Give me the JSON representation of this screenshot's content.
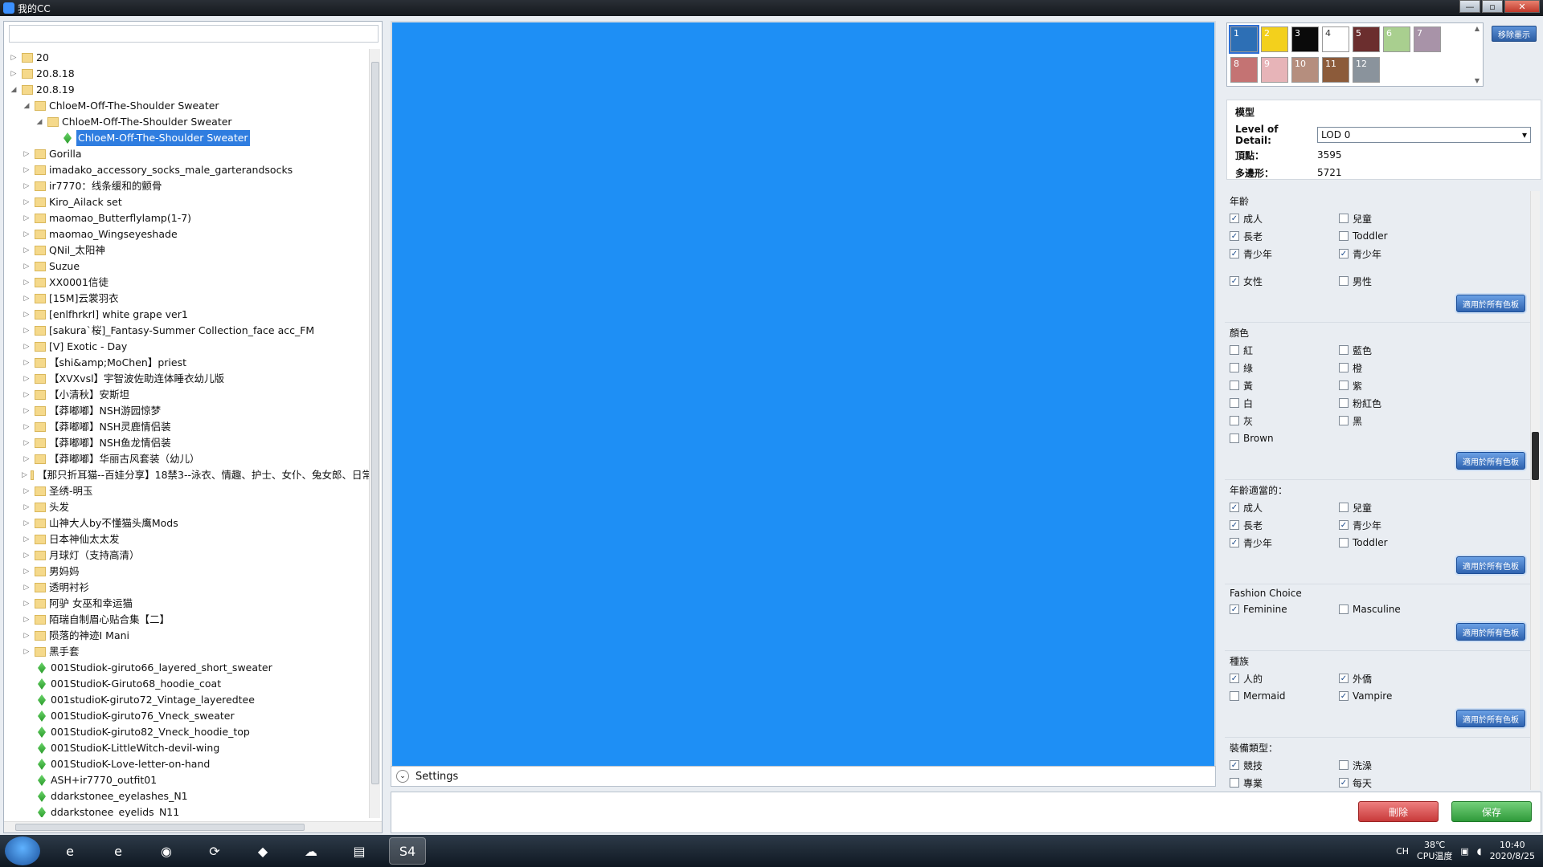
{
  "window": {
    "title": "我的CC",
    "min": "—",
    "max": "▫",
    "close": "✕"
  },
  "tree": {
    "rows": [
      {
        "label": "20",
        "type": "folder",
        "level": 0,
        "exp": "▷"
      },
      {
        "label": "20.8.18",
        "type": "folder",
        "level": 0,
        "exp": "▷"
      },
      {
        "label": "20.8.19",
        "type": "folder",
        "level": 0,
        "exp": "◢"
      },
      {
        "label": "ChloeM-Off-The-Shoulder Sweater",
        "type": "folder",
        "level": 1,
        "exp": "◢"
      },
      {
        "label": "ChloeM-Off-The-Shoulder Sweater",
        "type": "folder",
        "level": 2,
        "exp": "◢"
      },
      {
        "label": "ChloeM-Off-The-Shoulder Sweater",
        "type": "item",
        "level": 3,
        "exp": "",
        "selected": true
      },
      {
        "label": "Gorilla",
        "type": "folder",
        "level": 1,
        "exp": "▷"
      },
      {
        "label": "imadako_accessory_socks_male_garterandsocks",
        "type": "folder",
        "level": 1,
        "exp": "▷"
      },
      {
        "label": "ir7770：线条缓和的颤骨",
        "type": "folder",
        "level": 1,
        "exp": "▷"
      },
      {
        "label": "Kiro_Ailack set",
        "type": "folder",
        "level": 1,
        "exp": "▷"
      },
      {
        "label": "maomao_Butterflylamp(1-7)",
        "type": "folder",
        "level": 1,
        "exp": "▷"
      },
      {
        "label": "maomao_Wingseyeshade",
        "type": "folder",
        "level": 1,
        "exp": "▷"
      },
      {
        "label": "QNil_太阳神",
        "type": "folder",
        "level": 1,
        "exp": "▷"
      },
      {
        "label": "Suzue",
        "type": "folder",
        "level": 1,
        "exp": "▷"
      },
      {
        "label": "XX0001信徒",
        "type": "folder",
        "level": 1,
        "exp": "▷"
      },
      {
        "label": "[15M]云裳羽衣",
        "type": "folder",
        "level": 1,
        "exp": "▷"
      },
      {
        "label": "[enlfhrkrl] white grape ver1",
        "type": "folder",
        "level": 1,
        "exp": "▷"
      },
      {
        "label": "[sakura`桜]_Fantasy-Summer Collection_face acc_FM",
        "type": "folder",
        "level": 1,
        "exp": "▷"
      },
      {
        "label": "[V] Exotic - Day",
        "type": "folder",
        "level": 1,
        "exp": "▷"
      },
      {
        "label": "【shi&amp;MoChen】priest",
        "type": "folder",
        "level": 1,
        "exp": "▷"
      },
      {
        "label": "【XVXvsl】宇智波佐助连体睡衣幼儿版",
        "type": "folder",
        "level": 1,
        "exp": "▷"
      },
      {
        "label": "【小清秋】安斯坦",
        "type": "folder",
        "level": 1,
        "exp": "▷"
      },
      {
        "label": "【莽嘟嘟】NSH游园惊梦",
        "type": "folder",
        "level": 1,
        "exp": "▷"
      },
      {
        "label": "【莽嘟嘟】NSH灵鹿情侣装",
        "type": "folder",
        "level": 1,
        "exp": "▷"
      },
      {
        "label": "【莽嘟嘟】NSH鱼龙情侣装",
        "type": "folder",
        "level": 1,
        "exp": "▷"
      },
      {
        "label": "【莽嘟嘟】华丽古风套装（幼儿）",
        "type": "folder",
        "level": 1,
        "exp": "▷"
      },
      {
        "label": "【那只折耳猫--百娃分享】18禁3--泳衣、情趣、护士、女仆、兔女郎、日常",
        "type": "folder",
        "level": 1,
        "exp": "▷"
      },
      {
        "label": "圣绣-明玉",
        "type": "folder",
        "level": 1,
        "exp": "▷"
      },
      {
        "label": "头发",
        "type": "folder",
        "level": 1,
        "exp": "▷"
      },
      {
        "label": "山神大人by不懂猫头鹰Mods",
        "type": "folder",
        "level": 1,
        "exp": "▷"
      },
      {
        "label": "日本神仙太太发",
        "type": "folder",
        "level": 1,
        "exp": "▷"
      },
      {
        "label": "月球灯（支持高清）",
        "type": "folder",
        "level": 1,
        "exp": "▷"
      },
      {
        "label": "男妈妈",
        "type": "folder",
        "level": 1,
        "exp": "▷"
      },
      {
        "label": "透明衬衫",
        "type": "folder",
        "level": 1,
        "exp": "▷"
      },
      {
        "label": "阿驴 女巫和幸运猫",
        "type": "folder",
        "level": 1,
        "exp": "▷"
      },
      {
        "label": "陌瑞自制眉心贴合集【二】",
        "type": "folder",
        "level": 1,
        "exp": "▷"
      },
      {
        "label": "陨落的神迹I Mani",
        "type": "folder",
        "level": 1,
        "exp": "▷"
      },
      {
        "label": "黑手套",
        "type": "folder",
        "level": 1,
        "exp": "▷"
      },
      {
        "label": "001Studiok-giruto66_layered_short_sweater",
        "type": "item",
        "level": 1,
        "exp": ""
      },
      {
        "label": "001StudioK-Giruto68_hoodie_coat",
        "type": "item",
        "level": 1,
        "exp": ""
      },
      {
        "label": "001studioK-giruto72_Vintage_layeredtee",
        "type": "item",
        "level": 1,
        "exp": ""
      },
      {
        "label": "001StudioK-giruto76_Vneck_sweater",
        "type": "item",
        "level": 1,
        "exp": ""
      },
      {
        "label": "001StudioK-giruto82_Vneck_hoodie_top",
        "type": "item",
        "level": 1,
        "exp": ""
      },
      {
        "label": "001StudioK-LittleWitch-devil-wing",
        "type": "item",
        "level": 1,
        "exp": ""
      },
      {
        "label": "001StudioK-Love-letter-on-hand",
        "type": "item",
        "level": 1,
        "exp": ""
      },
      {
        "label": "ASH+ir7770_outfit01",
        "type": "item",
        "level": 1,
        "exp": ""
      },
      {
        "label": "ddarkstonee_eyelashes_N1",
        "type": "item",
        "level": 1,
        "exp": ""
      },
      {
        "label": "ddarkstonee_eyelids_N11",
        "type": "item",
        "level": 1,
        "exp": ""
      }
    ]
  },
  "viewport": {
    "color": "#1e8ff5",
    "settings_label": "Settings"
  },
  "swatches": [
    {
      "n": "1",
      "color": "#2d6fb5",
      "selected": true
    },
    {
      "n": "2",
      "color": "#f3d01c"
    },
    {
      "n": "3",
      "color": "#0a0a0a"
    },
    {
      "n": "4",
      "color": "#ffffff"
    },
    {
      "n": "5",
      "color": "#6b2e2e"
    },
    {
      "n": "6",
      "color": "#a9cf8f"
    },
    {
      "n": "7",
      "color": "#a893a8"
    },
    {
      "n": "8",
      "color": "#c47373"
    },
    {
      "n": "9",
      "color": "#e7b4b8"
    },
    {
      "n": "10",
      "color": "#b58e7e"
    },
    {
      "n": "11",
      "color": "#8c5b3a"
    },
    {
      "n": "12",
      "color": "#8a939c"
    }
  ],
  "remove_button": "移除墨示",
  "model": {
    "title": "模型",
    "lod_label": "Level of Detail:",
    "lod_value": "LOD 0",
    "vertices_label": "頂點：",
    "vertices": "3595",
    "polygons_label": "多邊形：",
    "polygons": "5721"
  },
  "apply_label": "適用於所有色板",
  "sections": [
    {
      "title": "年齡",
      "items": [
        {
          "label": "成人",
          "checked": true
        },
        {
          "label": "兒童",
          "checked": false
        },
        {
          "label": "長老",
          "checked": true
        },
        {
          "label": "Toddler",
          "checked": false
        },
        {
          "label": "青少年",
          "checked": true
        },
        {
          "label": "青少年",
          "checked": true
        },
        {
          "label": "女性",
          "checked": true
        },
        {
          "label": "男性",
          "checked": false
        }
      ]
    },
    {
      "title": "顏色",
      "items": [
        {
          "label": "紅",
          "checked": false
        },
        {
          "label": "藍色",
          "checked": false
        },
        {
          "label": "綠",
          "checked": false
        },
        {
          "label": "橙",
          "checked": false
        },
        {
          "label": "黃",
          "checked": false
        },
        {
          "label": "紫",
          "checked": false
        },
        {
          "label": "白",
          "checked": false
        },
        {
          "label": "粉紅色",
          "checked": false
        },
        {
          "label": "灰",
          "checked": false
        },
        {
          "label": "黑",
          "checked": false
        },
        {
          "label": "Brown",
          "checked": false
        }
      ]
    },
    {
      "title": "年齡適當的：",
      "items": [
        {
          "label": "成人",
          "checked": true
        },
        {
          "label": "兒童",
          "checked": false
        },
        {
          "label": "長老",
          "checked": true
        },
        {
          "label": "青少年",
          "checked": true
        },
        {
          "label": "青少年",
          "checked": true
        },
        {
          "label": "Toddler",
          "checked": false
        }
      ]
    },
    {
      "title": "Fashion Choice",
      "items": [
        {
          "label": "Feminine",
          "checked": true
        },
        {
          "label": "Masculine",
          "checked": false
        }
      ]
    },
    {
      "title": "種族",
      "items": [
        {
          "label": "人的",
          "checked": true
        },
        {
          "label": "外僑",
          "checked": true
        },
        {
          "label": "Mermaid",
          "checked": false
        },
        {
          "label": "Vampire",
          "checked": true
        }
      ]
    },
    {
      "title": "裝備類型：",
      "items": [
        {
          "label": "競技",
          "checked": true
        },
        {
          "label": "洗澡",
          "checked": false
        },
        {
          "label": "專業",
          "checked": false
        },
        {
          "label": "每天",
          "checked": true
        }
      ]
    }
  ],
  "buttons": {
    "delete": "刪除",
    "save": "保存"
  },
  "taskbar": {
    "lang": "CH",
    "temp": "38℃",
    "temp_label": "CPU温度",
    "time": "10:40",
    "date": "2020/8/25"
  }
}
